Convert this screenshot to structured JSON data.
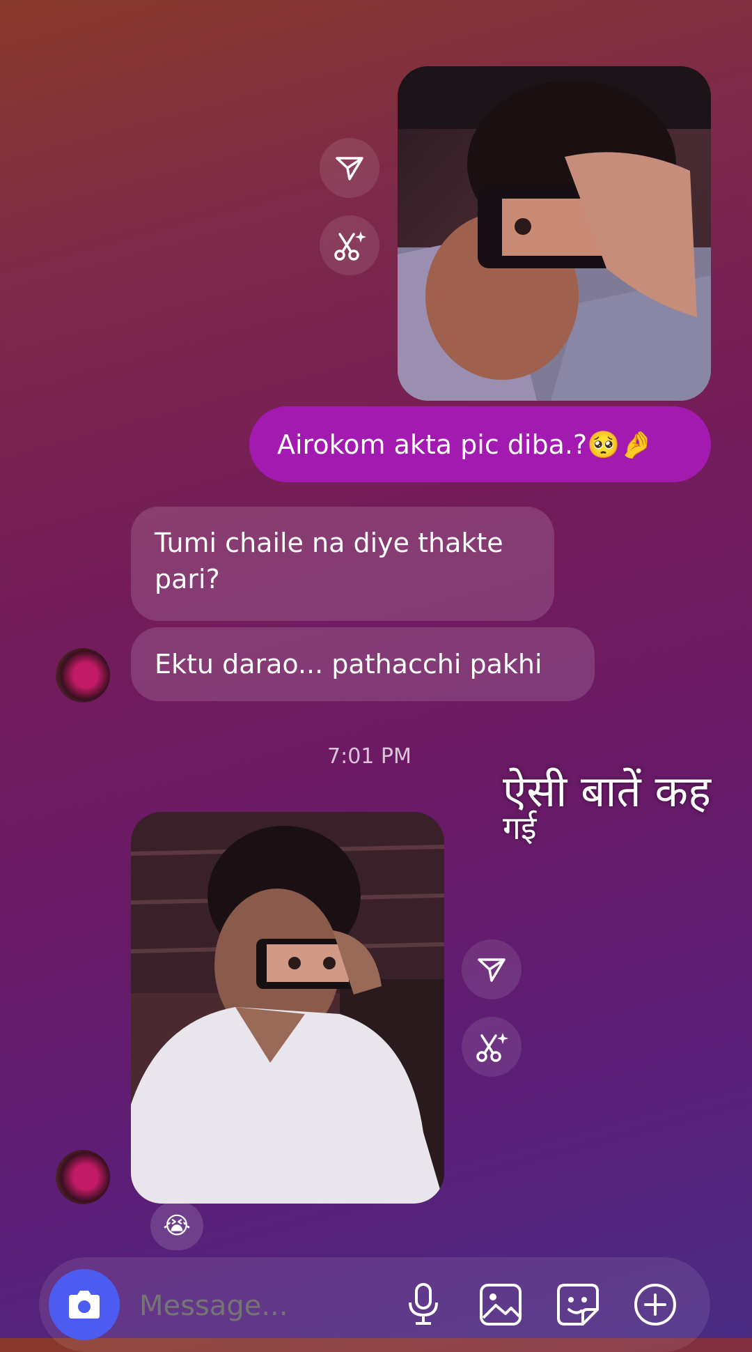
{
  "messages": {
    "outgoing_text": "Airokom akta pic diba.?🥺🤌",
    "incoming_1": "Tumi chaile na diye thakte pari?",
    "incoming_2": "Ektu darao... pathacchi pakhi",
    "timestamp": "7:01 PM",
    "reaction_emoji": "😭"
  },
  "overlay": {
    "line1": "ऐसी बातें कह",
    "line2": "गई"
  },
  "composer": {
    "placeholder": "Message..."
  },
  "icons": {
    "share": "share-icon",
    "remix": "scissors-sparkle-icon",
    "camera": "camera-icon",
    "mic": "microphone-icon",
    "gallery": "gallery-icon",
    "sticker": "sticker-icon",
    "plus": "plus-icon"
  },
  "colors": {
    "outgoing_bubble": "#a21ab0",
    "camera_button": "#4d5cf0"
  }
}
